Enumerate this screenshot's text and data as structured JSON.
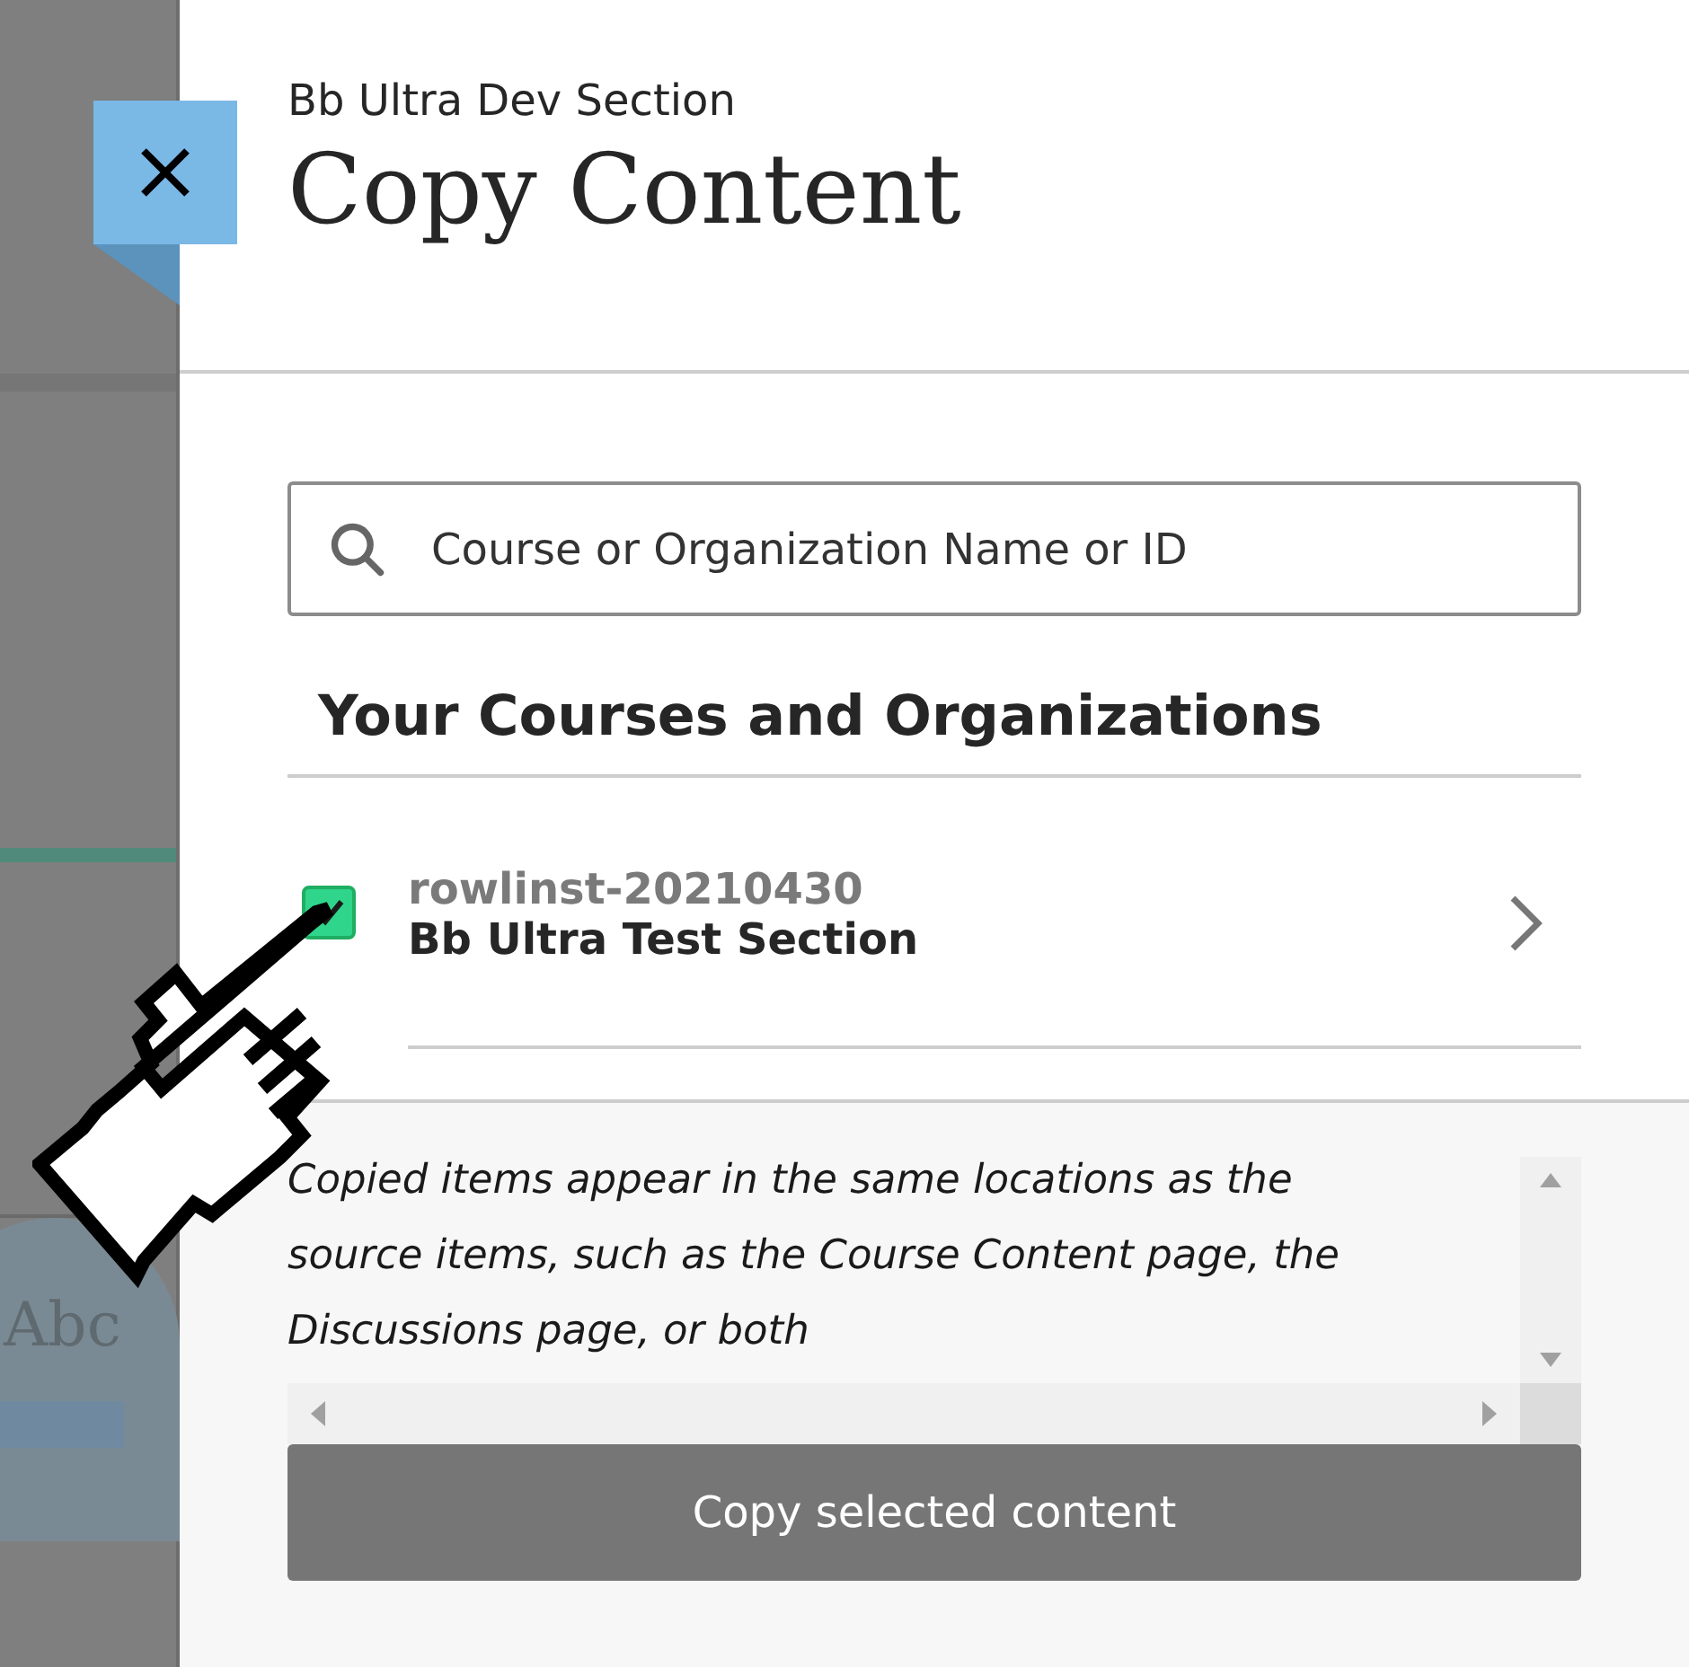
{
  "background": {
    "text": "Abc"
  },
  "panel": {
    "subtitle": "Bb Ultra Dev Section",
    "title": "Copy Content"
  },
  "search": {
    "placeholder": "Course or Organization Name or ID"
  },
  "section_heading": "Your Courses and Organizations",
  "courses": [
    {
      "code": "rowlinst-20210430",
      "name": "Bb Ultra Test Section",
      "checked": true
    }
  ],
  "footer": {
    "note": "Copied items appear in the same locations as the source items, such as the Course Content page, the Discussions page, or both",
    "button": "Copy selected content"
  }
}
